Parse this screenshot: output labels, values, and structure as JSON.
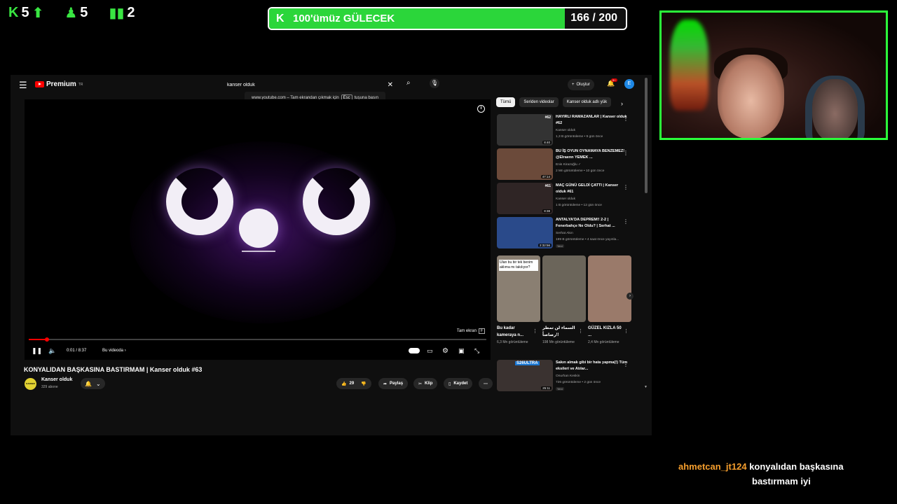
{
  "stream_stats": {
    "followers": "5",
    "subs": "5",
    "bars": "2",
    "kick_icon": "kick-k-icon",
    "arrow_icon": "up-arrow-icon"
  },
  "goal": {
    "title": "100'ümüz GÜLECEK",
    "count": "166 / 200",
    "progress_fraction": 0.83,
    "color": "#2bd63a"
  },
  "browser": {
    "logo_label": "Premium",
    "logo_tm": "TR",
    "search_value": "kanser olduk",
    "create_label": "Oluştur",
    "notifications": "9+",
    "avatar_letter": "E",
    "fs_tip_pre": "www.youtube.com – Tam ekrandan çıkmak için",
    "fs_tip_key": "Esc",
    "fs_tip_post": "tuşuna basın"
  },
  "player": {
    "fullscreen_hint": "Tam ekran",
    "fullscreen_key": "F",
    "time": "0:01 / 8:37",
    "chapter": "Bu videoda",
    "progress_fraction": 0.04
  },
  "video": {
    "title": "KONYALIDAN BAŞKASINA BASTIRMAM | Kanser olduk #63",
    "channel": "Kanser olduk",
    "subscribers": "329 abone",
    "channel_logo_text": "KANSER OLDUK",
    "likes": "29",
    "share": "Paylaş",
    "clip": "Klip",
    "save": "Kaydet"
  },
  "sidebar": {
    "chips": [
      "Tümü",
      "Seriden videolar",
      "Kanser olduk adlı yük"
    ],
    "recs": [
      {
        "title": "HAYIRLI RAMAZANLAR | Kanser olduk #62",
        "channel": "Kanser olduk",
        "meta": "1,3 B görüntüleme • 9 gün önce",
        "duration": "8:40",
        "ep": "#62",
        "new": "",
        "color": "#333"
      },
      {
        "title": "BU İŞ OYUN OYNAMAYA BENZEMEZ! @Elraenn YEMEK ...",
        "channel": "Enis Kirazoğlu ✓",
        "meta": "2 Mn görüntüleme • 10 gün önce",
        "duration": "47:14",
        "ep": "",
        "new": "",
        "color": "#6b4a3a"
      },
      {
        "title": "MAÇ GÜNÜ GELDİ ÇATTI | Kanser olduk #61",
        "channel": "Kanser olduk",
        "meta": "1 B görüntüleme • 12 gün önce",
        "duration": "8:38",
        "ep": "#61",
        "new": "",
        "color": "#2f2525"
      },
      {
        "title": "ANTALYA'DA DEPREM!! 2-2 | Fenerbahçe Ne Oldu? | Serhat ...",
        "channel": "Serhat Akın",
        "meta": "199 B görüntüleme • 4 saat önce yayınla...",
        "duration": "2:32:56",
        "ep": "",
        "new": "Yeni",
        "color": "#2a4a8a"
      }
    ],
    "shorts": [
      {
        "title": "Bu kadar kameraya n...",
        "views": "6,3 Mn görüntüleme",
        "color": "#8a7f72",
        "overlay": "Ulan bu bir tek benim aklıma mı takılıyor?"
      },
      {
        "title": "السماء لن تمطر رصاصاً!!",
        "views": "198 Mn görüntüleme",
        "color": "#6b655a",
        "overlay": ""
      },
      {
        "title": "GÜZEL KIZLA 50 ...",
        "views": "2,4 Mn görüntüleme",
        "color": "#9a7a6a",
        "overlay": ""
      }
    ],
    "rec5": {
      "title": "Sakın almak gibi bir hata yapma(!) Tüm eksileri ve Atılar...",
      "channel": "Onurhan Keskin",
      "meta": "726 görüntüleme • 2 gün önce",
      "duration": "25:11",
      "new": "Yeni",
      "label": "S26ULTRA",
      "color": "#3a3230"
    }
  },
  "chat": {
    "user": "ahmetcan_jt124",
    "message_line1": "konyalıdan başkasına",
    "message_line2": "bastırmam iyi"
  }
}
